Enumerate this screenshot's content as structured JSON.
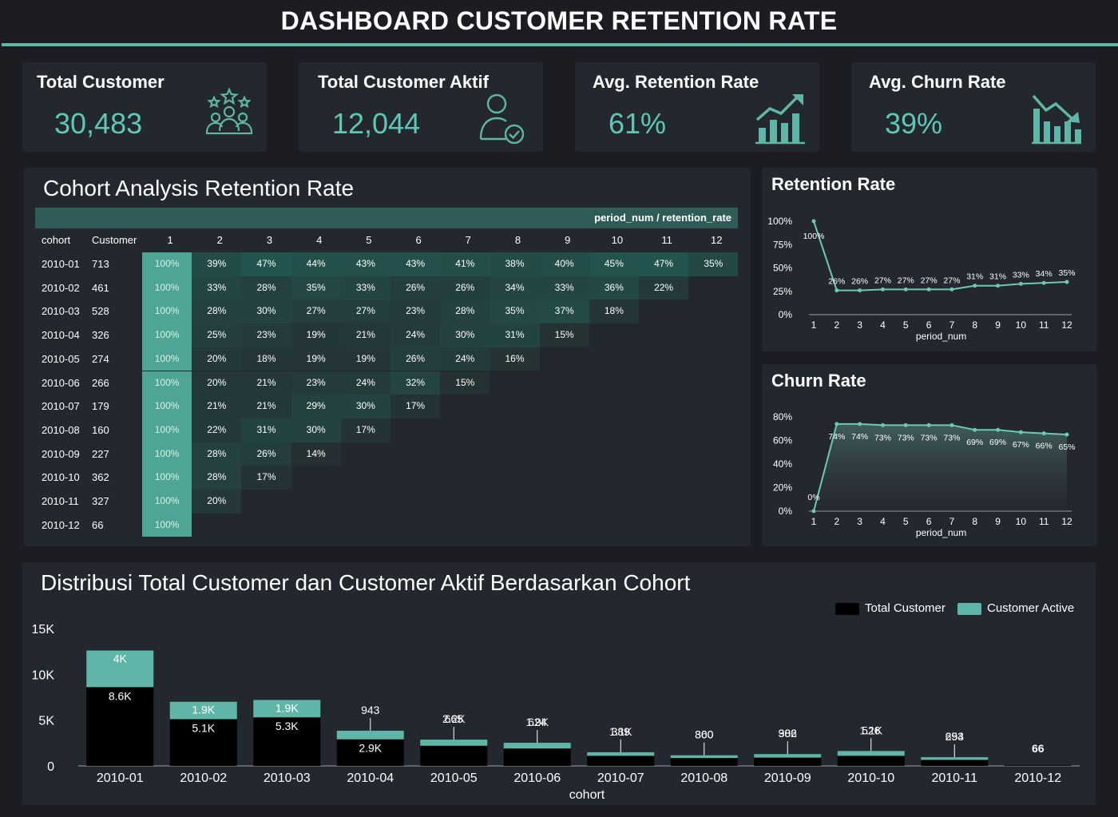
{
  "header": {
    "title": "DASHBOARD CUSTOMER RETENTION RATE"
  },
  "kpis": {
    "total_customer": {
      "label": "Total Customer",
      "value": "30,483",
      "icon": "customers-stars-icon"
    },
    "total_active": {
      "label": "Total Customer Aktif",
      "value": "12,044",
      "icon": "user-check-icon"
    },
    "avg_retention": {
      "label": "Avg. Retention Rate",
      "value": "61%",
      "icon": "chart-up-icon"
    },
    "avg_churn": {
      "label": "Avg. Churn Rate",
      "value": "39%",
      "icon": "chart-down-icon"
    }
  },
  "colors": {
    "accent": "#5fb5a8",
    "background": "#1b1d22",
    "card": "#23272e",
    "total_bar": "#000000",
    "active_bar": "#5fb5a8"
  },
  "chart_data": [
    {
      "type": "heatmap",
      "title": "Cohort Analysis Retention Rate",
      "header_label": "period_num / retention_rate",
      "row_header": "cohort",
      "count_header": "Customer",
      "columns": [
        "1",
        "2",
        "3",
        "4",
        "5",
        "6",
        "7",
        "8",
        "9",
        "10",
        "11",
        "12"
      ],
      "rows": [
        {
          "cohort": "2010-01",
          "customers": "713",
          "values": [
            "100%",
            "39%",
            "47%",
            "44%",
            "43%",
            "43%",
            "41%",
            "38%",
            "40%",
            "45%",
            "47%",
            "35%"
          ]
        },
        {
          "cohort": "2010-02",
          "customers": "461",
          "values": [
            "100%",
            "33%",
            "28%",
            "35%",
            "33%",
            "26%",
            "26%",
            "34%",
            "33%",
            "36%",
            "22%"
          ]
        },
        {
          "cohort": "2010-03",
          "customers": "528",
          "values": [
            "100%",
            "28%",
            "30%",
            "27%",
            "27%",
            "23%",
            "28%",
            "35%",
            "37%",
            "18%"
          ]
        },
        {
          "cohort": "2010-04",
          "customers": "326",
          "values": [
            "100%",
            "25%",
            "23%",
            "19%",
            "21%",
            "24%",
            "30%",
            "31%",
            "15%"
          ]
        },
        {
          "cohort": "2010-05",
          "customers": "274",
          "values": [
            "100%",
            "20%",
            "18%",
            "19%",
            "19%",
            "26%",
            "24%",
            "16%"
          ]
        },
        {
          "cohort": "2010-06",
          "customers": "266",
          "values": [
            "100%",
            "20%",
            "21%",
            "23%",
            "24%",
            "32%",
            "15%"
          ]
        },
        {
          "cohort": "2010-07",
          "customers": "179",
          "values": [
            "100%",
            "21%",
            "21%",
            "29%",
            "30%",
            "17%"
          ]
        },
        {
          "cohort": "2010-08",
          "customers": "160",
          "values": [
            "100%",
            "22%",
            "31%",
            "30%",
            "17%"
          ]
        },
        {
          "cohort": "2010-09",
          "customers": "227",
          "values": [
            "100%",
            "28%",
            "26%",
            "14%"
          ]
        },
        {
          "cohort": "2010-10",
          "customers": "362",
          "values": [
            "100%",
            "28%",
            "17%"
          ]
        },
        {
          "cohort": "2010-11",
          "customers": "327",
          "values": [
            "100%",
            "20%"
          ]
        },
        {
          "cohort": "2010-12",
          "customers": "66",
          "values": [
            "100%"
          ]
        }
      ]
    },
    {
      "type": "line",
      "title": "Retention Rate",
      "xlabel": "period_num",
      "x": [
        1,
        2,
        3,
        4,
        5,
        6,
        7,
        8,
        9,
        10,
        11,
        12
      ],
      "values": [
        100,
        26,
        26,
        27,
        27,
        27,
        27,
        31,
        31,
        33,
        34,
        35
      ],
      "value_labels": [
        "100%",
        "26%",
        "26%",
        "27%",
        "27%",
        "27%",
        "27%",
        "31%",
        "31%",
        "33%",
        "34%",
        "35%"
      ],
      "yticks": [
        "0%",
        "25%",
        "50%",
        "75%",
        "100%"
      ],
      "ylim": [
        0,
        100
      ]
    },
    {
      "type": "area",
      "title": "Churn Rate",
      "xlabel": "period_num",
      "x": [
        1,
        2,
        3,
        4,
        5,
        6,
        7,
        8,
        9,
        10,
        11,
        12
      ],
      "values": [
        0,
        74,
        74,
        73,
        73,
        73,
        73,
        69,
        69,
        67,
        66,
        65
      ],
      "value_labels": [
        "0%",
        "74%",
        "74%",
        "73%",
        "73%",
        "73%",
        "73%",
        "69%",
        "69%",
        "67%",
        "66%",
        "65%"
      ],
      "yticks": [
        "0%",
        "20%",
        "40%",
        "60%",
        "80%"
      ],
      "ylim": [
        0,
        80
      ]
    },
    {
      "type": "bar",
      "title": "Distribusi Total Customer dan Customer Aktif Berdasarkan Cohort",
      "xlabel": "cohort",
      "categories": [
        "2010-01",
        "2010-02",
        "2010-03",
        "2010-04",
        "2010-05",
        "2010-06",
        "2010-07",
        "2010-08",
        "2010-09",
        "2010-10",
        "2010-11",
        "2010-12"
      ],
      "yticks": [
        "0",
        "5K",
        "10K",
        "15K"
      ],
      "ylim": [
        0,
        15000
      ],
      "legend_position": "top-right",
      "series": [
        {
          "name": "Total Customer",
          "values": [
            8600,
            5100,
            5300,
            2900,
            2200,
            1900,
            1100,
            860,
            906,
            1100,
            654,
            66
          ],
          "labels": [
            "8.6K",
            "5.1K",
            "5.3K",
            "2.9K",
            "2.2K",
            "1.9K",
            "1.1K",
            "860",
            "906",
            "1.1K",
            "654",
            "66"
          ]
        },
        {
          "name": "Customer Active",
          "values": [
            4000,
            1900,
            1900,
            943,
            665,
            624,
            389,
            300,
            382,
            526,
            293,
            0
          ],
          "labels": [
            "4K",
            "1.9K",
            "1.9K",
            "943",
            "665",
            "624",
            "389",
            "300",
            "382",
            "526",
            "293",
            ""
          ]
        }
      ]
    }
  ]
}
